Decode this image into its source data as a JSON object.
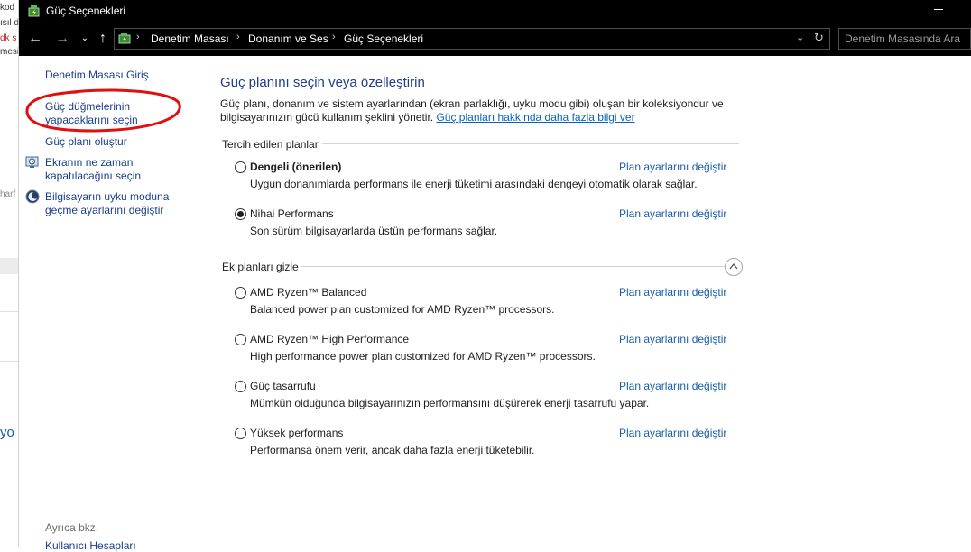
{
  "background": {
    "fragments": [
      "kod",
      "ısıl d",
      "dk s",
      "mesi",
      "harf",
      "yo"
    ]
  },
  "window": {
    "title": "Güç Seçenekleri"
  },
  "address_bar": {
    "crumbs": [
      "Denetim Masası",
      "Donanım ve Ses",
      "Güç Seçenekleri"
    ],
    "search_placeholder": "Denetim Masasında Ara"
  },
  "sidebar": {
    "home": "Denetim Masası Giriş",
    "power_buttons": "Güç düğmelerinin\nyapacaklarını seçin",
    "create_plan": "Güç planı oluştur",
    "display_off": "Ekranın ne zaman\nkapatılacağını seçin",
    "sleep": "Bilgisayarın uyku moduna\ngeçme ayarlarını değiştir",
    "see_also": "Ayrıca bkz.",
    "user_accounts": "Kullanıcı Hesapları"
  },
  "main": {
    "title": "Güç planını seçin veya özelleştirin",
    "description": "Güç planı, donanım ve sistem ayarlarından (ekran parlaklığı, uyku modu gibi) oluşan bir koleksiyondur ve bilgisayarınızın gücü kullanım şeklini yönetir.",
    "learn_more": "Güç planları hakkında daha fazla bilgi ver",
    "preferred_header": "Tercih edilen planlar",
    "hide_header": "Ek planları gizle",
    "change_link": "Plan ayarlarını değiştir",
    "preferred_plans": [
      {
        "name": "Dengeli (önerilen)",
        "desc": "Uygun donanımlarda performans ile enerji tüketimi arasındaki dengeyi otomatik olarak sağlar.",
        "selected": false
      },
      {
        "name": "Nihai Performans",
        "desc": "Son sürüm bilgisayarlarda üstün performans sağlar.",
        "selected": true
      }
    ],
    "extra_plans": [
      {
        "name": "AMD Ryzen™ Balanced",
        "desc": "Balanced power plan customized for AMD Ryzen™ processors.",
        "selected": false
      },
      {
        "name": "AMD Ryzen™ High Performance",
        "desc": "High performance power plan customized for AMD Ryzen™ processors.",
        "selected": false
      },
      {
        "name": "Güç tasarrufu",
        "desc": "Mümkün olduğunda bilgisayarınızın performansını düşürerek enerji tasarrufu yapar.",
        "selected": false
      },
      {
        "name": "Yüksek performans",
        "desc": "Performansa önem verir, ancak daha fazla enerji tüketebilir.",
        "selected": false
      }
    ]
  }
}
